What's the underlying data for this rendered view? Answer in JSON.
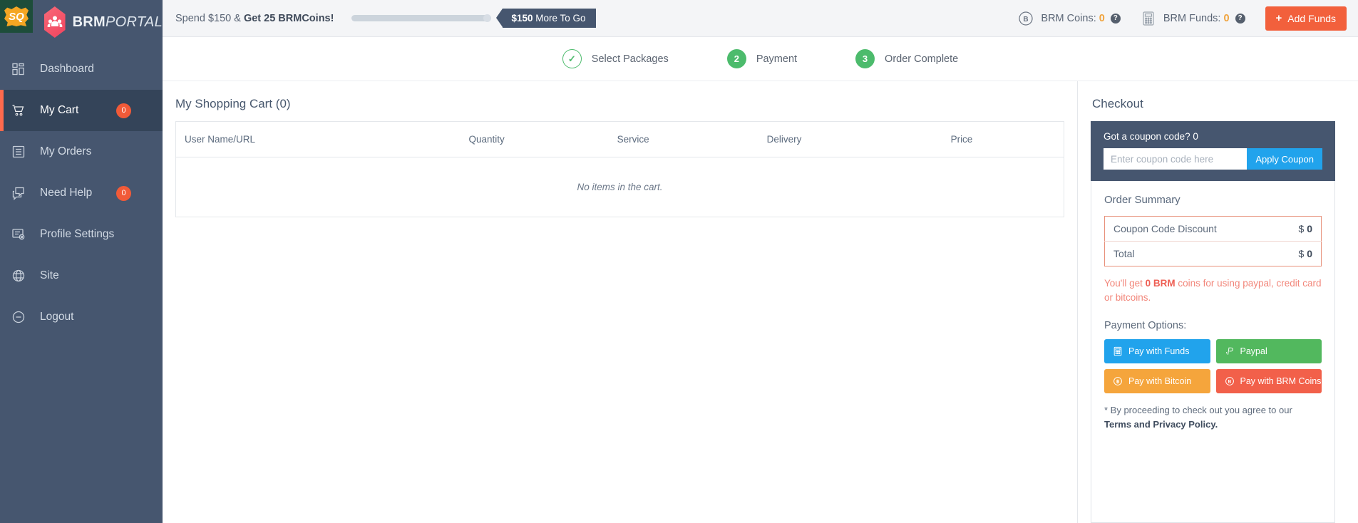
{
  "brand": {
    "badge_text": "SQ",
    "name_bold": "BRM",
    "name_italic": "PORTAL",
    "logo_icon": "people-hexagon-icon"
  },
  "sidebar": {
    "items": [
      {
        "label": "Dashboard",
        "icon": "dashboard-grid-icon",
        "badge": null,
        "active": false
      },
      {
        "label": "My Cart",
        "icon": "shopping-cart-icon",
        "badge": "0",
        "active": true
      },
      {
        "label": "My Orders",
        "icon": "list-document-icon",
        "badge": null,
        "active": false
      },
      {
        "label": "Need Help",
        "icon": "chat-bubble-icon",
        "badge": "0",
        "active": false
      },
      {
        "label": "Profile Settings",
        "icon": "profile-gear-icon",
        "badge": null,
        "active": false
      },
      {
        "label": "Site",
        "icon": "globe-icon",
        "badge": null,
        "active": false
      },
      {
        "label": "Logout",
        "icon": "logout-icon",
        "badge": null,
        "active": false
      }
    ]
  },
  "topbar": {
    "promo_prefix": "Spend $150 & ",
    "promo_bold": "Get 25 BRMCoins!",
    "progress_percent": 0,
    "more_to_go_amount": "$150",
    "more_to_go_text": " More To Go",
    "coins_label": "BRM Coins:",
    "coins_value": "0",
    "coins_icon": "bitcoin-b-circle-icon",
    "coins_help_icon": "question-mark-icon",
    "funds_label": "BRM Funds:",
    "funds_value": "0",
    "funds_icon": "calculator-icon",
    "funds_help_icon": "question-mark-icon",
    "add_funds_label": "Add Funds",
    "add_funds_plus": "+",
    "accent_orange": "#f2603c",
    "accent_amber": "#f0a33c"
  },
  "stepper": {
    "steps": [
      {
        "marker": "✓",
        "label": "Select Packages",
        "state": "done"
      },
      {
        "marker": "2",
        "label": "Payment",
        "state": "current"
      },
      {
        "marker": "3",
        "label": "Order Complete",
        "state": "upcoming"
      }
    ],
    "green": "#4cbb6c"
  },
  "cart": {
    "title": "My Shopping Cart (0)",
    "columns": [
      "User Name/URL",
      "Quantity",
      "Service",
      "Delivery",
      "Price"
    ],
    "empty_message": "No items in the cart.",
    "rows": []
  },
  "checkout": {
    "heading": "Checkout",
    "coupon_label": "Got a coupon code? 0",
    "coupon_placeholder": "Enter coupon code here",
    "coupon_value": "",
    "apply_label": "Apply Coupon",
    "summary_title": "Order Summary",
    "summary_rows": [
      {
        "label": "Coupon Code Discount",
        "currency": "$",
        "value": "0"
      },
      {
        "label": "Total",
        "currency": "$",
        "value": "0"
      }
    ],
    "brm_note_prefix": "You'll get ",
    "brm_note_bold": "0 BRM",
    "brm_note_suffix": " coins for using paypal, credit card or bitcoins.",
    "payment_options_label": "Payment Options:",
    "payment_buttons": [
      {
        "label": "Pay with Funds",
        "icon": "calculator-icon",
        "color": "#21a3ec"
      },
      {
        "label": "Paypal",
        "icon": "paypal-icon",
        "color": "#52b85e"
      },
      {
        "label": "Pay with Bitcoin",
        "icon": "bitcoin-icon",
        "color": "#f5a53c"
      },
      {
        "label": "Pay with BRM Coins",
        "icon": "brm-coin-icon",
        "color": "#f2604a"
      }
    ],
    "terms_prefix": "* By proceeding to check out you agree to our ",
    "terms_bold": "Terms and Privacy Policy."
  }
}
